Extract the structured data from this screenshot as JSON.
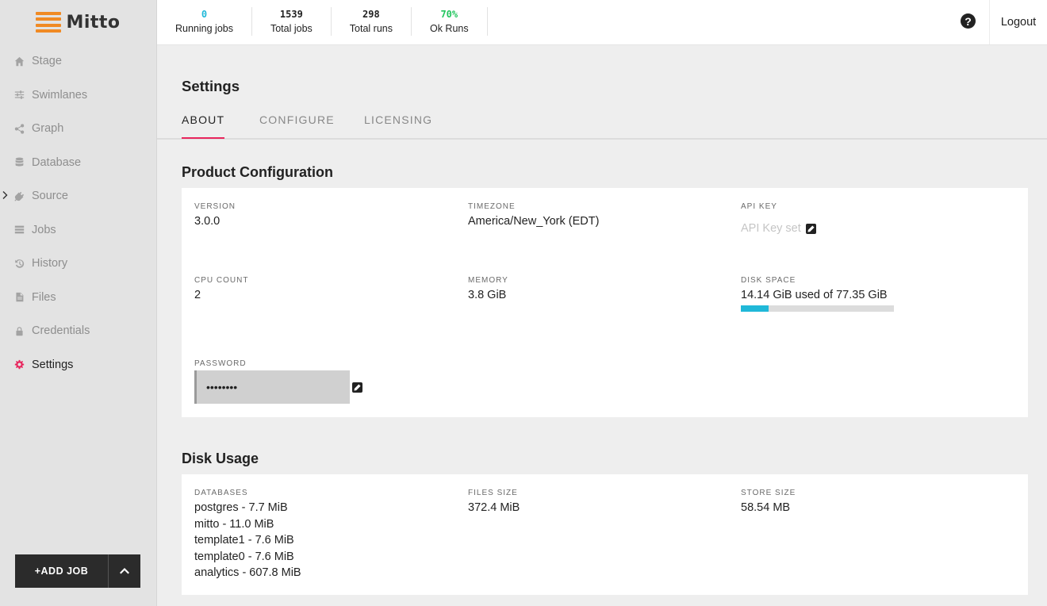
{
  "brand": {
    "name": "Mitto",
    "logo_color": "#f08a24"
  },
  "sidebar": {
    "items": [
      {
        "label": "Stage",
        "icon": "home-icon"
      },
      {
        "label": "Swimlanes",
        "icon": "sliders-icon"
      },
      {
        "label": "Graph",
        "icon": "share-icon"
      },
      {
        "label": "Database",
        "icon": "database-icon"
      },
      {
        "label": "Source",
        "icon": "plug-icon",
        "has_caret": true
      },
      {
        "label": "Jobs",
        "icon": "list-icon"
      },
      {
        "label": "History",
        "icon": "history-icon"
      },
      {
        "label": "Files",
        "icon": "file-icon"
      },
      {
        "label": "Credentials",
        "icon": "lock-icon"
      },
      {
        "label": "Settings",
        "icon": "gear-icon",
        "active": true
      }
    ],
    "add_job_label": "+ADD JOB"
  },
  "topbar": {
    "stats": [
      {
        "value": "0",
        "label": "Running jobs",
        "color": "#20b8d8"
      },
      {
        "value": "1539",
        "label": "Total jobs",
        "color": "#222222"
      },
      {
        "value": "298",
        "label": "Total runs",
        "color": "#222222"
      },
      {
        "value": "70%",
        "label": "Ok Runs",
        "color": "#22c55e"
      }
    ],
    "help_glyph": "?",
    "logout_label": "Logout"
  },
  "page": {
    "title": "Settings",
    "tabs": [
      {
        "label": "ABOUT",
        "active": true
      },
      {
        "label": "CONFIGURE",
        "active": false
      },
      {
        "label": "LICENSING",
        "active": false
      }
    ]
  },
  "product_config": {
    "title": "Product Configuration",
    "version": {
      "label": "VERSION",
      "value": "3.0.0"
    },
    "timezone": {
      "label": "TIMEZONE",
      "value": "America/New_York (EDT)"
    },
    "api_key": {
      "label": "API KEY",
      "value": "API Key set"
    },
    "cpu_count": {
      "label": "CPU COUNT",
      "value": "2"
    },
    "memory": {
      "label": "MEMORY",
      "value": "3.8 GiB"
    },
    "disk_space": {
      "label": "DISK SPACE",
      "value": "14.14 GiB used of 77.35 GiB",
      "used_fraction": 0.183
    },
    "password": {
      "label": "PASSWORD",
      "value": "••••••••"
    }
  },
  "disk_usage": {
    "title": "Disk Usage",
    "databases": {
      "label": "DATABASES",
      "items": [
        "postgres - 7.7 MiB",
        "mitto - 11.0 MiB",
        "template1 - 7.6 MiB",
        "template0 - 7.6 MiB",
        "analytics - 607.8 MiB"
      ]
    },
    "files_size": {
      "label": "FILES SIZE",
      "value": "372.4 MiB"
    },
    "store_size": {
      "label": "STORE SIZE",
      "value": "58.54 MB"
    }
  },
  "colors": {
    "accent": "#e8265d",
    "progress": "#20b8d8"
  }
}
